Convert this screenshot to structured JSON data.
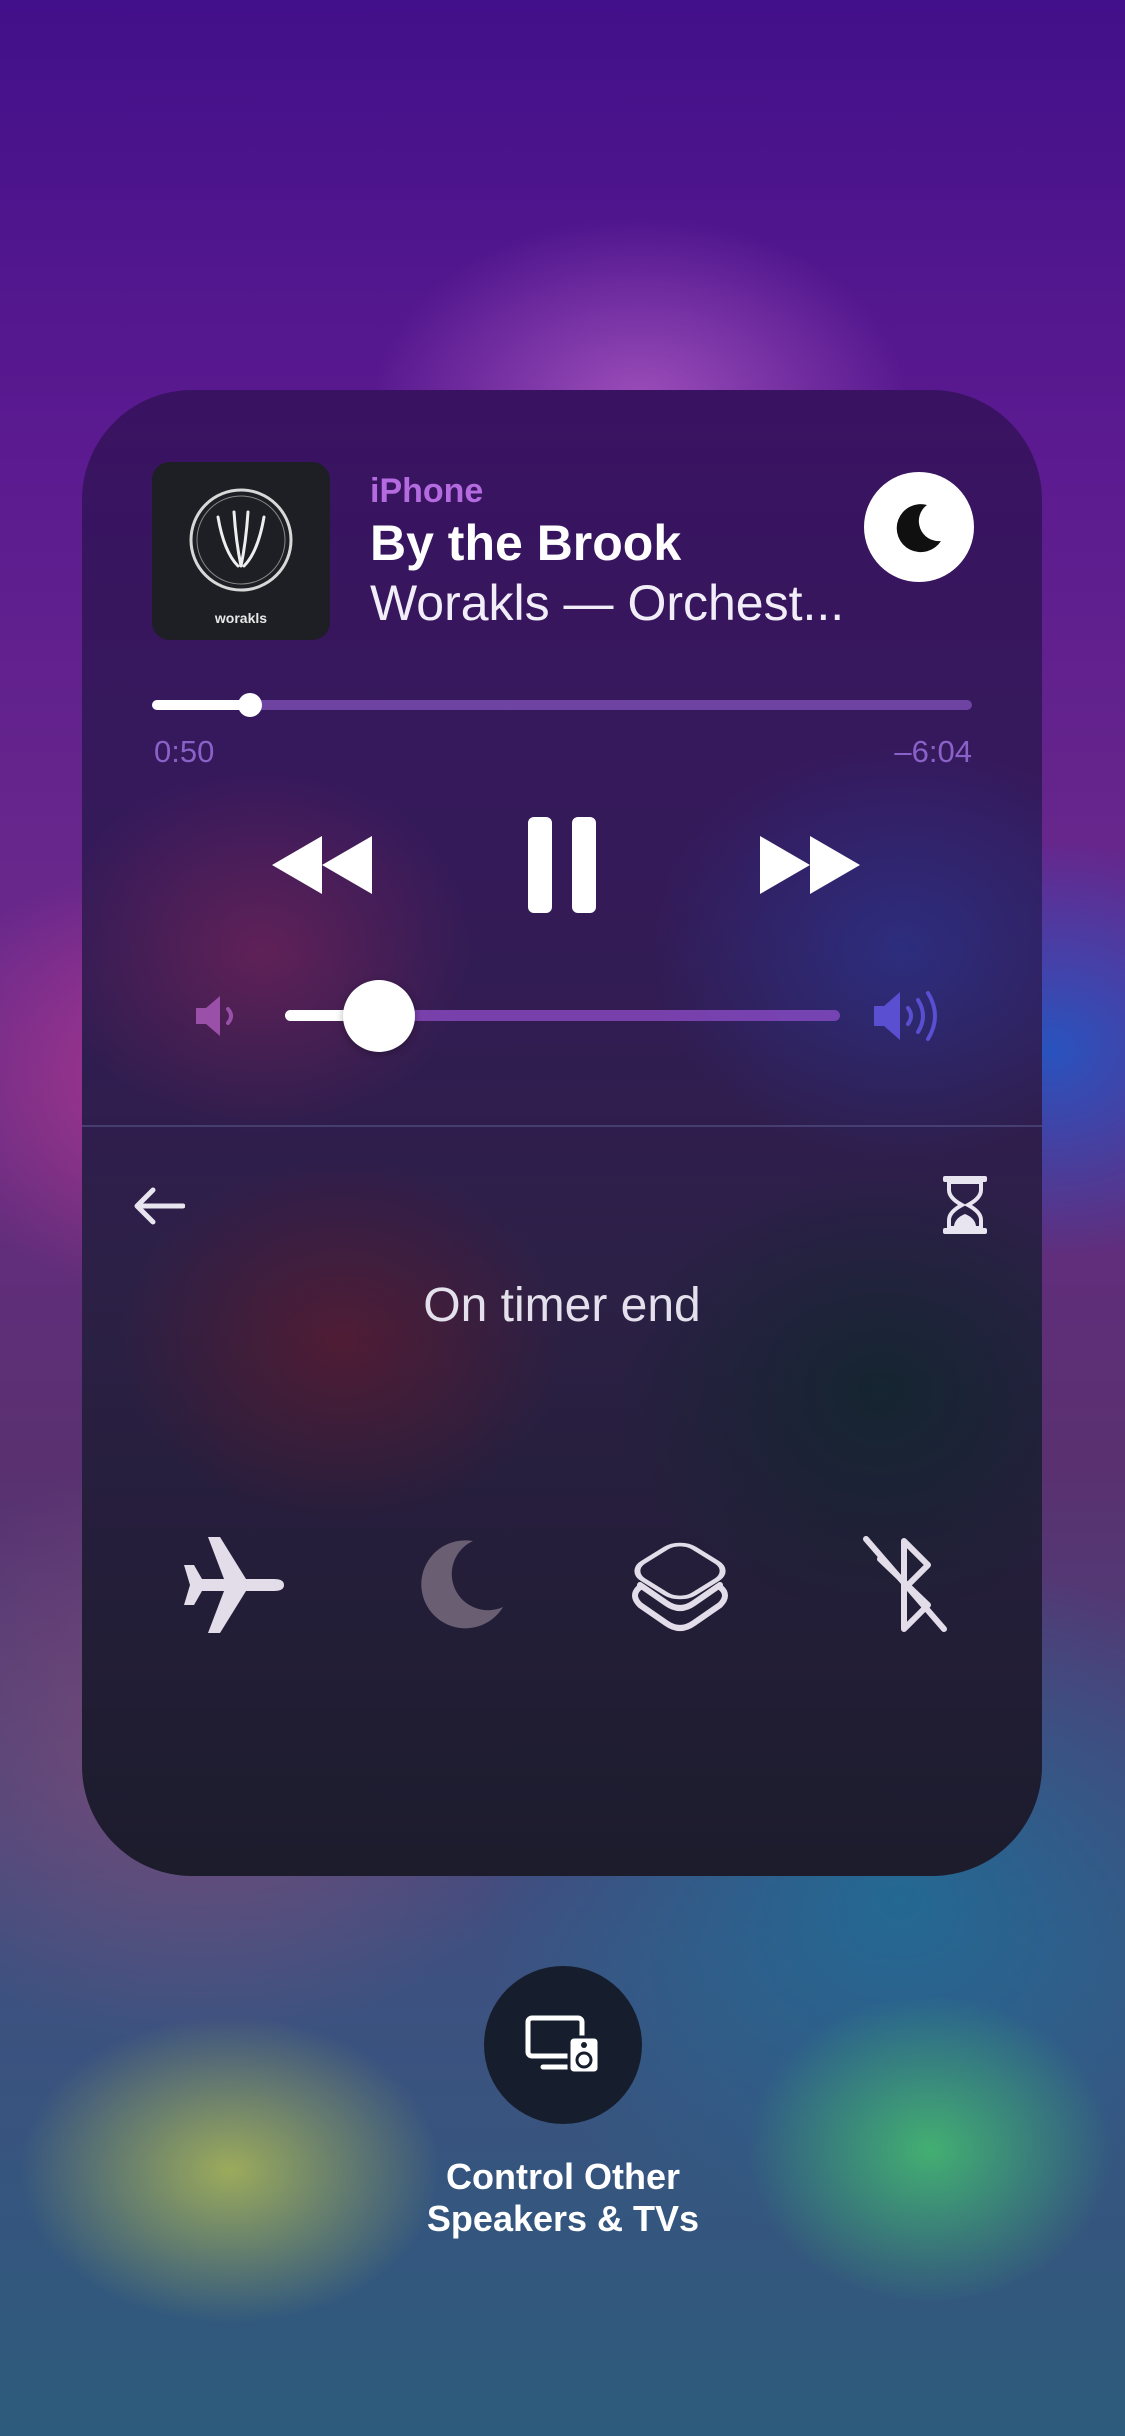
{
  "now_playing": {
    "source": "iPhone",
    "title": "By the Brook",
    "subtitle": "Worakls — Orchest...",
    "artwork_text": "worakls",
    "elapsed": "0:50",
    "remaining": "–6:04",
    "progress_fraction": 0.12,
    "volume_fraction": 0.17
  },
  "transport": {
    "rewind_icon": "backward-icon",
    "pause_icon": "pause-icon",
    "forward_icon": "forward-icon"
  },
  "timer": {
    "label": "On timer end"
  },
  "actions": [
    {
      "icon": "airplane-icon"
    },
    {
      "icon": "moon-icon"
    },
    {
      "icon": "layers-icon"
    },
    {
      "icon": "bluetooth-off-icon"
    }
  ],
  "other_speakers": {
    "line1": "Control Other",
    "line2": "Speakers & TVs"
  },
  "colors": {
    "accent_purple": "#b46be0",
    "time_text": "#8a62c7",
    "progress_track": "#8c5ac8",
    "white": "#ffffff"
  }
}
